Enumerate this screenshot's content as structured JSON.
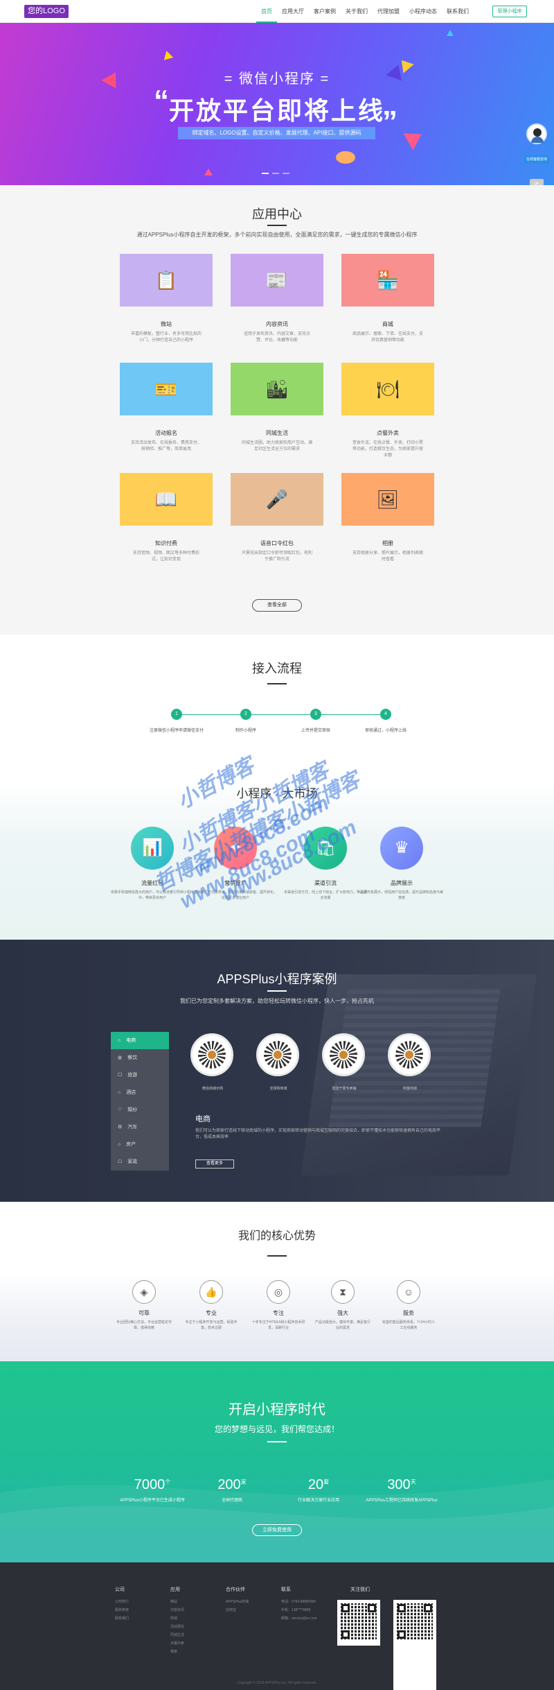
{
  "header": {
    "logo": "您的LOGO",
    "nav": [
      "首页",
      "应用大厅",
      "客户案例",
      "关于我们",
      "代理加盟",
      "小程序动态",
      "联系我们"
    ],
    "admin_button": "管理小程序"
  },
  "banner": {
    "small_title": "= 微信小程序 =",
    "big_title": "开放平台即将上线",
    "open_quote": "“",
    "close_quote": "”",
    "sub": "绑定域名、LOGO设置、自定义价格、发展代理、API接口、提供源码"
  },
  "side": {
    "tag": "在线客服咨询",
    "icons": [
      "phone-icon",
      "wechat-icon",
      "qq-icon"
    ]
  },
  "apps": {
    "title": "应用中心",
    "desc": "通过APPSPlus小程序自主开发的框架，多个前向实现自由使用，全面满足您的需求，一键生成您的专属微信小程序",
    "items": [
      {
        "name": "微站",
        "desc": "丰富的模板，整行业，有多可用比拟的小门，分钟打造自己的小程序",
        "color": "#c6b2f2",
        "icon": "📋"
      },
      {
        "name": "内容资讯",
        "desc": "适用于发布资讯、内容文章，支持点赞、评论、收藏等功能",
        "color": "#c9a8ef",
        "icon": "📰"
      },
      {
        "name": "商城",
        "desc": "商品展示、搜索、下单、在线支付，支持优惠营销等功能",
        "color": "#f7908f",
        "icon": "🏪"
      },
      {
        "name": "活动报名",
        "desc": "支持活动发布、在线报名、费用支付、核销验、推广等，简单易用",
        "color": "#6ec7f5",
        "icon": "🎫"
      },
      {
        "name": "同城生活",
        "desc": "同城生活圈，助力商家和用户互动，满足社区生活全方位的需求",
        "color": "#95d86a",
        "icon": "🏙"
      },
      {
        "name": "点餐外卖",
        "desc": "堂食外送、在线点餐、外卖、打印小票等功能，打造餐饮生态，为商家提升营业额",
        "color": "#ffd24d",
        "icon": "🍽"
      },
      {
        "name": "知识付费",
        "desc": "支持音频、视频、图文等多种付费形式，让知识变现",
        "color": "#ffcf55",
        "icon": "📖"
      },
      {
        "name": "语音口令红包",
        "desc": "只需说出指定口令即可领取红包，有利于推广和引流",
        "color": "#e8bd95",
        "icon": "🎤"
      },
      {
        "name": "相册",
        "desc": "支持相册分享、照片展示，相册列表随时查看",
        "color": "#ffa86b",
        "icon": "🖼"
      }
    ],
    "more": "查看全部"
  },
  "process": {
    "title": "接入流程",
    "steps": [
      {
        "num": "1",
        "label": "注册微信小程序申请微信支付"
      },
      {
        "num": "2",
        "label": "制作小程序"
      },
      {
        "num": "3",
        "label": "上传并提交审核"
      },
      {
        "num": "4",
        "label": "审核通过，小程序上线"
      }
    ]
  },
  "market": {
    "title": "小程序 · 大市场",
    "items": [
      {
        "name": "流量红包",
        "desc": "依靠手机端微信庞大的用户，可以将流量引导到小程序中，带来更多用户",
        "colors": [
          "#4fd7c3",
          "#2bb8c9"
        ],
        "icon": "📊"
      },
      {
        "name": "营销推广",
        "desc": "营销推广方式多样化，帮助商家快速获客，提升转化，挖掘更多潜在用户",
        "colors": [
          "#ff8a7a",
          "#ff6d8c"
        ],
        "icon": "✦"
      },
      {
        "name": "渠道引流",
        "desc": "多渠道引流方式，线上线下结合，扩大影响力，带来更多流量",
        "colors": [
          "#39d3a0",
          "#19b38a"
        ],
        "icon": "🛍"
      },
      {
        "name": "品牌展示",
        "desc": "品牌形象展示，增强用户信任感，提升品牌知名度与美誉度",
        "colors": [
          "#8aa4ff",
          "#6d7cf5"
        ],
        "icon": "♛"
      }
    ],
    "watermarks": [
      "小哲博客",
      "小哲博客小哲博客",
      "哲博客小哲博客小哲博客",
      "www.8uc8.com",
      "www.8uc8.com",
      "www.8uc8.com"
    ]
  },
  "cases": {
    "title": "APPSPlus小程序案例",
    "desc": "我们已为您定制多套解决方案，助您轻松玩转微信小程序，快人一步，抢占先机",
    "menu": [
      "电商",
      "餐饮",
      "旅游",
      "酒店",
      "婚纱",
      "汽车",
      "房产",
      "家政"
    ],
    "qrs": [
      "微信商城示例",
      "全球购商城",
      "团团干果专卖铺",
      "阿富商城"
    ],
    "name": "电商",
    "text": "我们可以为商家打造线下移动商城的小程序，实现商家移动营销与商城互联网的完美结合，即使不懂技术也能够快速拥有自己的电商平台，低成本高效率",
    "button": "查看更多"
  },
  "advantages": {
    "title": "我们的核心优势",
    "items": [
      {
        "name": "可靠",
        "desc": "专业团队精心打造，平台运营稳定可靠，值得信赖",
        "icon": "◈"
      },
      {
        "name": "专业",
        "desc": "专注于小程序开发与运营，经验丰富，技术过硬",
        "icon": "👍"
      },
      {
        "name": "专注",
        "desc": "十年专注于HTML5和小程序技术研发，深耕行业",
        "icon": "◎"
      },
      {
        "name": "强大",
        "desc": "产品功能强大，模块丰富，满足各行业的需求",
        "icon": "⧗"
      },
      {
        "name": "服务",
        "desc": "完善的售后服务体系，7×24小时人工在线服务",
        "icon": "☺"
      }
    ]
  },
  "green": {
    "title": "开启小程序时代",
    "sub": "您的梦想与远见，我们帮您达成！",
    "stats": [
      {
        "num": "7000",
        "unit": "个",
        "label": "APPSPlus小程序平台已生成小程序"
      },
      {
        "num": "200",
        "unit": "家",
        "label": "全国代理商"
      },
      {
        "num": "20",
        "unit": "套",
        "label": "行业解决方案行业应用"
      },
      {
        "num": "300",
        "unit": "天",
        "label": "APPSPlus工程师已持续研发APPSPlus"
      }
    ],
    "button": "立即免费使用"
  },
  "footer": {
    "cols": [
      {
        "title": "公司",
        "items": [
          "公司简介",
          "服务条款",
          "联系我们"
        ]
      },
      {
        "title": "应用",
        "items": [
          "微站",
          "内容资讯",
          "商城",
          "活动报名",
          "同城生活",
          "点餐外卖",
          "相册"
        ]
      },
      {
        "title": "合作伙伴",
        "items": [
          "APPSPlus商城",
          "应用宝"
        ]
      },
      {
        "title": "联系",
        "items": [
          "电话：0755-88889999",
          "手机：138****8888",
          "邮箱：service@xx.com"
        ]
      },
      {
        "title": "关注我们",
        "items": []
      }
    ],
    "copyright": "Copyright © 2019 APPSPlus Inc. All rights reserved."
  }
}
